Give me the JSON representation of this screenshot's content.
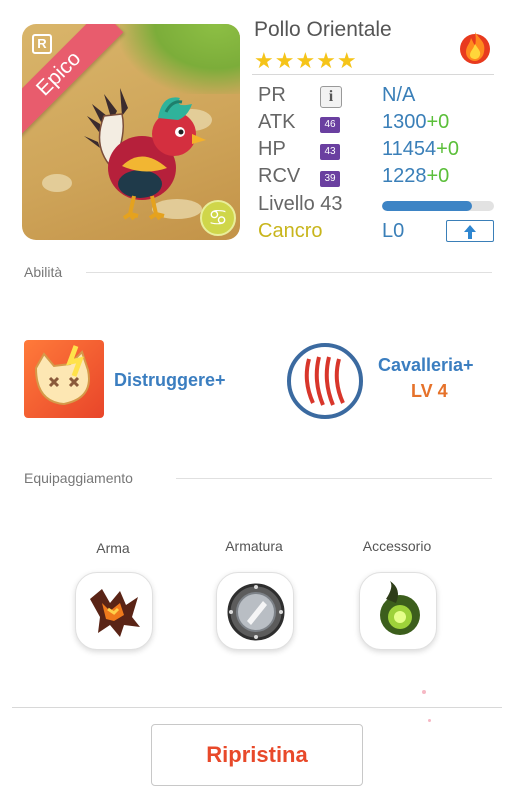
{
  "creature": {
    "name": "Pollo Orientale",
    "rarity_badge": "R",
    "rarity": "Epico",
    "stars": "★★★★★",
    "star_count": 5,
    "element_icon": "fire-icon",
    "zodiac_icon": "cancer-zodiac-icon",
    "zodiac_glyph": "♋"
  },
  "stats": {
    "pr": {
      "label": "PR",
      "value": "N/A"
    },
    "atk": {
      "label": "ATK",
      "badge": "46",
      "value": "1300",
      "bonus": "+0"
    },
    "hp": {
      "label": "HP",
      "badge": "43",
      "value": "11454",
      "bonus": "+0"
    },
    "rcv": {
      "label": "RCV",
      "badge": "39",
      "value": "1228",
      "bonus": "+0"
    },
    "level": {
      "label": "Livello 43",
      "progress": 0.8
    },
    "zodiac": {
      "label": "Cancro",
      "value": "L0"
    }
  },
  "abilities": {
    "title": "Abilità",
    "skill1": {
      "name": "Distruggere+",
      "icon": "broken-face-icon"
    },
    "skill2": {
      "name": "Cavalleria+",
      "level": "LV 4",
      "icon": "claw-marks-icon"
    }
  },
  "equipment": {
    "title": "Equipaggiamento",
    "slots": [
      {
        "label": "Arma",
        "icon": "claw-weapon-icon"
      },
      {
        "label": "Armatura",
        "icon": "shield-armor-icon"
      },
      {
        "label": "Accessorio",
        "icon": "green-orb-accessory-icon"
      }
    ]
  },
  "actions": {
    "reset_label": "Ripristina"
  },
  "colors": {
    "accent_blue": "#3b7ec0",
    "reset_red": "#e8492a",
    "star_yellow": "#f5c419",
    "plus_green": "#5bbf3a",
    "ribbon_pink": "#e85c6d"
  }
}
